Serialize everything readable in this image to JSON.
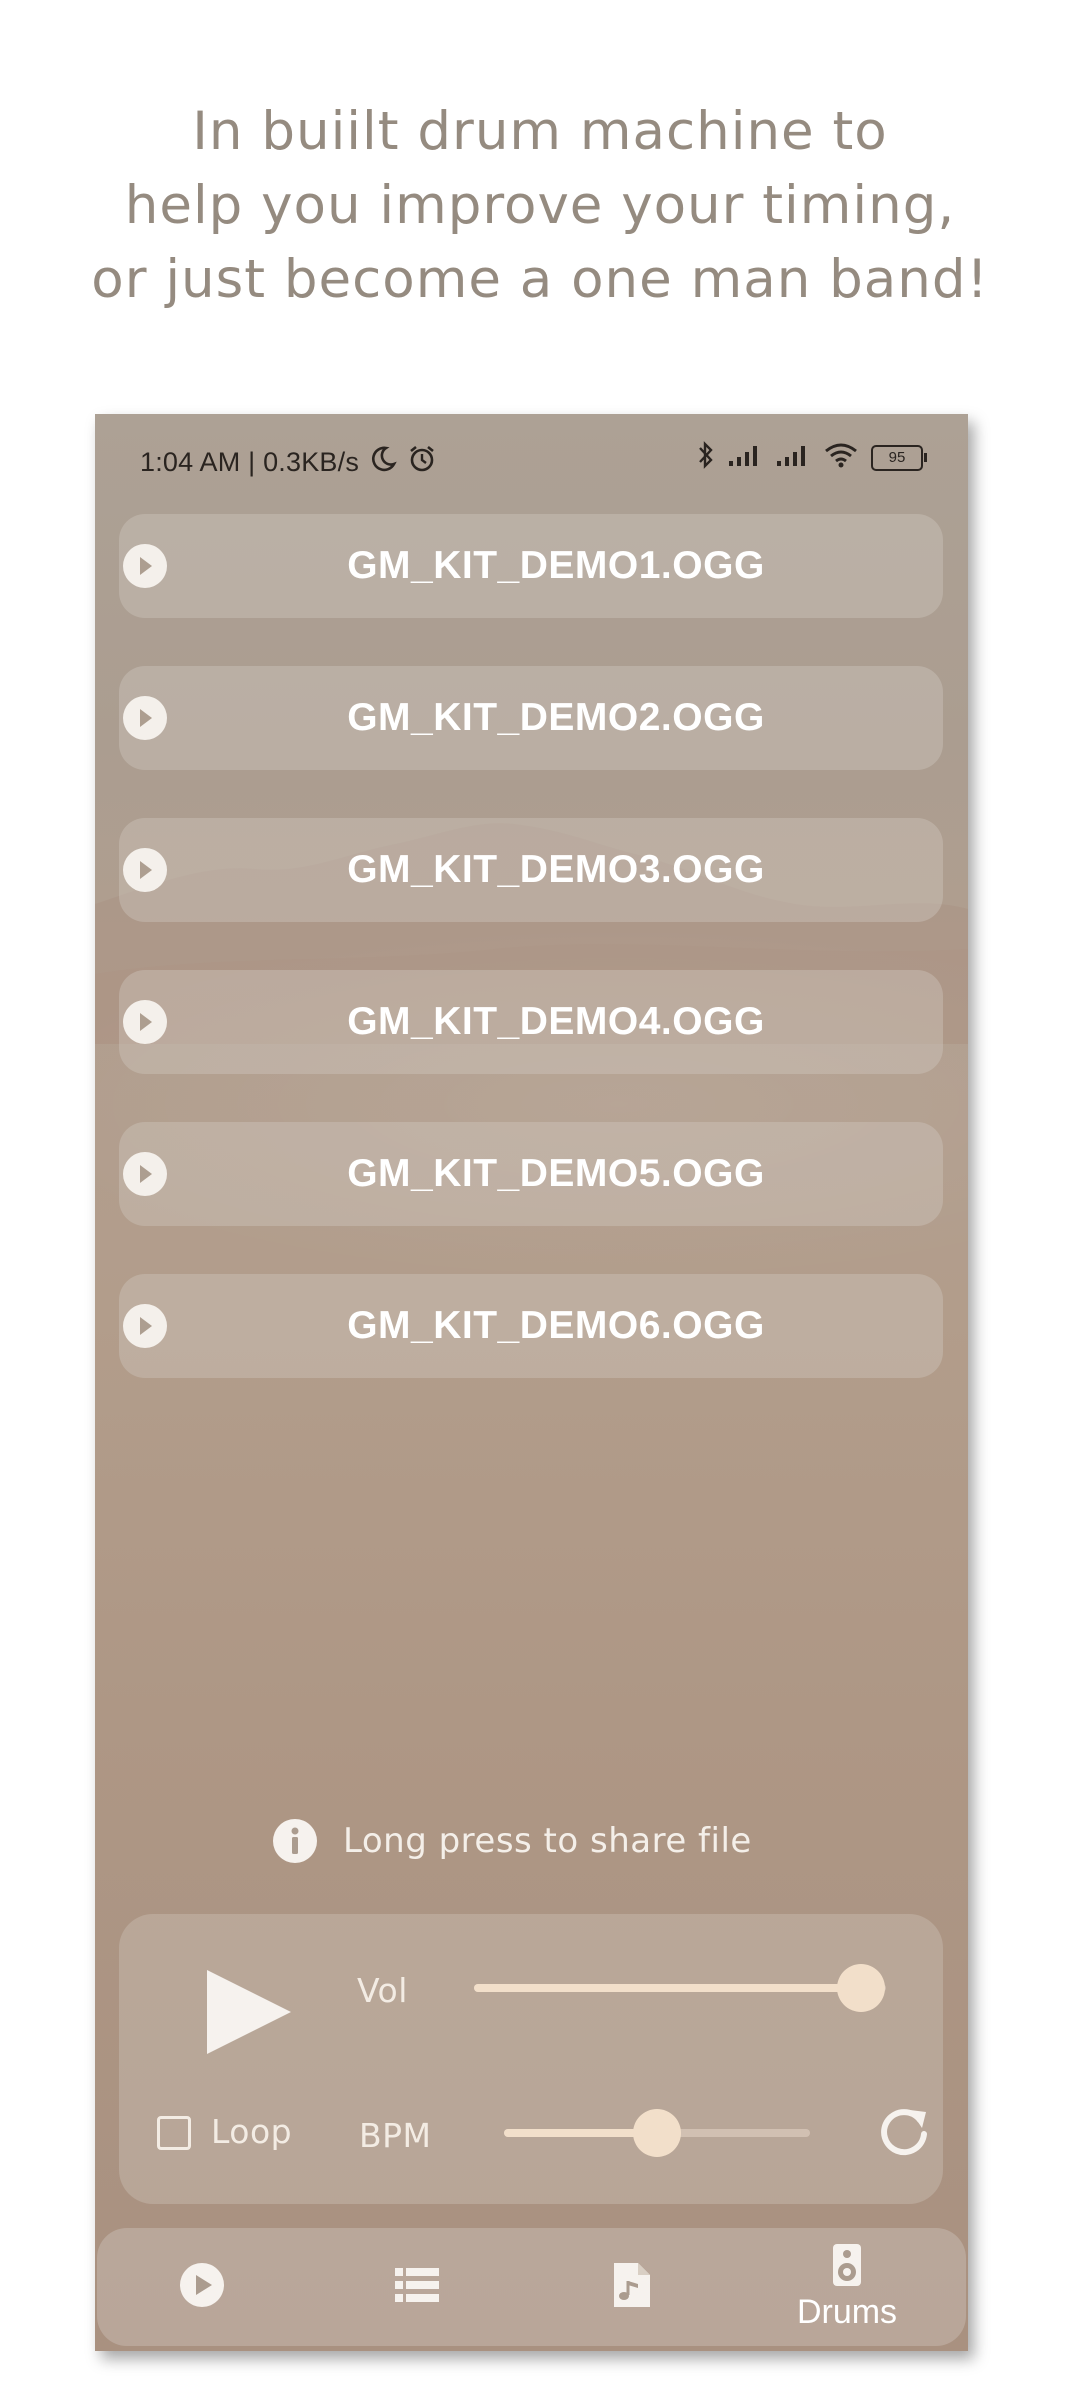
{
  "headline": {
    "line1": "In buiilt drum machine to",
    "line2": "help you improve your timing,",
    "line3": "or just become a one man band!"
  },
  "status_bar": {
    "time_speed": "1:04 AM | 0.3KB/s",
    "battery": "95"
  },
  "tracks": [
    {
      "name": "GM_KIT_DEMO1.OGG",
      "icon": "play-icon"
    },
    {
      "name": "GM_KIT_DEMO2.OGG",
      "icon": "play-icon"
    },
    {
      "name": "GM_KIT_DEMO3.OGG",
      "icon": "play-icon"
    },
    {
      "name": "GM_KIT_DEMO4.OGG",
      "icon": "play-icon"
    },
    {
      "name": "GM_KIT_DEMO5.OGG",
      "icon": "play-icon"
    },
    {
      "name": "GM_KIT_DEMO6.OGG",
      "icon": "play-icon"
    }
  ],
  "hint": {
    "text": "Long press to share file",
    "icon": "info-icon"
  },
  "controls": {
    "vol_label": "Vol",
    "vol_value": 0.94,
    "loop_label": "Loop",
    "loop_checked": false,
    "bpm_label": "BPM",
    "bpm_value": 0.5
  },
  "nav": {
    "items": [
      {
        "icon": "play-icon",
        "label": ""
      },
      {
        "icon": "list-icon",
        "label": ""
      },
      {
        "icon": "music-file-icon",
        "label": ""
      },
      {
        "icon": "speaker-icon",
        "label": "Drums"
      }
    ]
  },
  "colors": {
    "headline": "#958b80",
    "accent": "#f2dfca",
    "phone_bg": "#ad9a8a"
  }
}
